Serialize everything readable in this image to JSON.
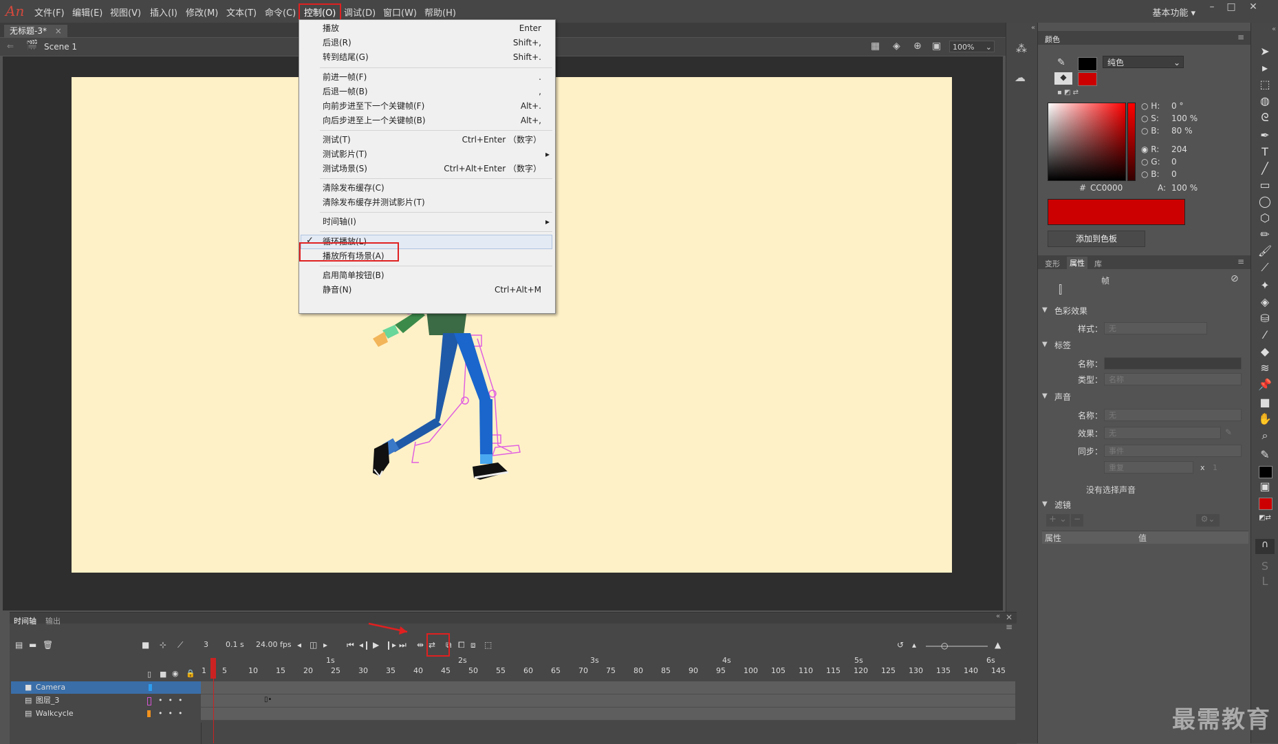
{
  "app": {
    "logo": "An"
  },
  "menubar": {
    "items": [
      {
        "label": "文件(F)"
      },
      {
        "label": "编辑(E)"
      },
      {
        "label": "视图(V)"
      },
      {
        "label": "插入(I)"
      },
      {
        "label": "修改(M)"
      },
      {
        "label": "文本(T)"
      },
      {
        "label": "命令(C)"
      },
      {
        "label": "控制(O)"
      },
      {
        "label": "调试(D)"
      },
      {
        "label": "窗口(W)"
      },
      {
        "label": "帮助(H)"
      }
    ],
    "workspace": "基本功能"
  },
  "document": {
    "tab": "无标题-3*",
    "scene": "Scene 1",
    "zoom": "100%"
  },
  "control_menu": {
    "items": [
      {
        "label": "播放",
        "shortcut": "Enter"
      },
      {
        "label": "后退(R)",
        "shortcut": "Shift+,"
      },
      {
        "label": "转到结尾(G)",
        "shortcut": "Shift+."
      },
      {
        "label": "前进一帧(F)",
        "shortcut": "."
      },
      {
        "label": "后退一帧(B)",
        "shortcut": ","
      },
      {
        "label": "向前步进至下一个关键帧(F)",
        "shortcut": "Alt+."
      },
      {
        "label": "向后步进至上一个关键帧(B)",
        "shortcut": "Alt+,"
      },
      {
        "label": "测试(T)",
        "shortcut": "Ctrl+Enter （数字）"
      },
      {
        "label": "测试影片(T)",
        "shortcut": ""
      },
      {
        "label": "测试场景(S)",
        "shortcut": "Ctrl+Alt+Enter （数字）"
      },
      {
        "label": "清除发布缓存(C)",
        "shortcut": ""
      },
      {
        "label": "清除发布缓存并测试影片(T)",
        "shortcut": ""
      },
      {
        "label": "时间轴(I)",
        "shortcut": ""
      },
      {
        "label": "循环播放(L)",
        "shortcut": ""
      },
      {
        "label": "播放所有场景(A)",
        "shortcut": ""
      },
      {
        "label": "启用简单按钮(B)",
        "shortcut": ""
      },
      {
        "label": "静音(N)",
        "shortcut": "Ctrl+Alt+M"
      }
    ],
    "check_mark": "✓"
  },
  "color_panel": {
    "tab": "颜色",
    "fill_type": "纯色",
    "H": "0 °",
    "S": "100 %",
    "B": "80 %",
    "R": "204",
    "G": "0",
    "Bv": "0",
    "hex_prefix": "#",
    "hex": "CC0000",
    "A": "100 %",
    "labels": {
      "H": "H:",
      "S": "S:",
      "B": "B:",
      "R": "R:",
      "G": "G:",
      "Bl": "B:",
      "A": "A:"
    },
    "add_swatch": "添加到色板",
    "fill_color": "#cc0000"
  },
  "props_panel": {
    "tabs": [
      "变形",
      "属性",
      "库"
    ],
    "frame_label": "帧",
    "color_effect": "色彩效果",
    "style_label": "样式：",
    "style_value": "无",
    "label_section": "标签",
    "name_label": "名称：",
    "type_label": "类型：",
    "type_value": "名称",
    "sound_section": "声音",
    "sound_name_label": "名称：",
    "sound_name_value": "无",
    "effect_label": "效果：",
    "effect_value": "无",
    "sync_label": "同步：",
    "sync_value": "事件",
    "repeat_value": "重复",
    "repeat_x": "x",
    "repeat_count": "1",
    "no_sound": "没有选择声音",
    "filter_section": "滤镜",
    "col_attr": "属性",
    "col_value": "值"
  },
  "timeline": {
    "tabs": [
      "时间轴",
      "输出"
    ],
    "current_frame": "3",
    "time": "0.1 s",
    "fps": "24.00 fps",
    "layers": [
      {
        "name": "Camera",
        "color": "#2d9df0",
        "selected": true
      },
      {
        "name": "图层_3",
        "color": "#d455d4",
        "selected": false
      },
      {
        "name": "Walkcycle",
        "color": "#f0921e",
        "selected": false
      }
    ],
    "frame_numbers": [
      "1",
      "5",
      "10",
      "15",
      "20",
      "25",
      "30",
      "35",
      "40",
      "45",
      "50",
      "55",
      "60",
      "65",
      "70",
      "75",
      "80",
      "85",
      "90",
      "95",
      "100",
      "105",
      "110",
      "115",
      "120",
      "125",
      "130",
      "135",
      "140",
      "145"
    ],
    "seconds": [
      "1s",
      "2s",
      "3s",
      "4s",
      "5s",
      "6s"
    ]
  },
  "watermark": "最需教育"
}
